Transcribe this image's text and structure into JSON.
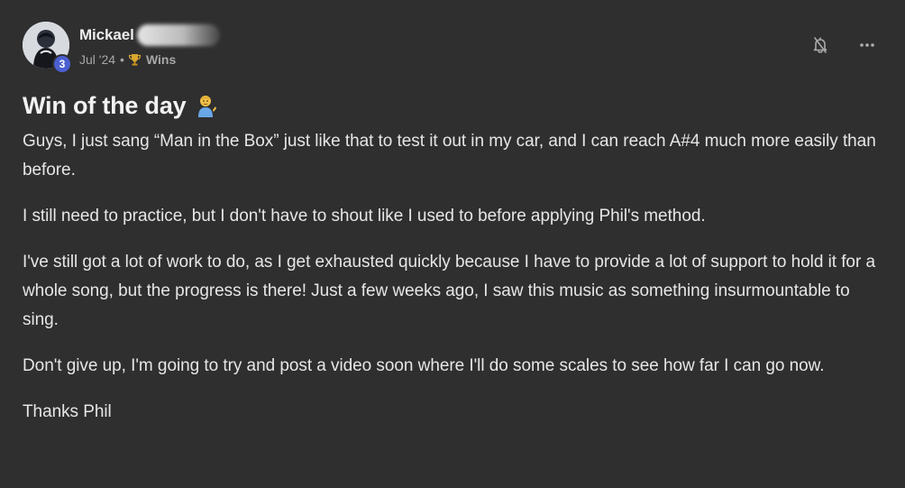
{
  "post": {
    "author": {
      "name": "Mickael",
      "level": "3"
    },
    "date": "Jul '24",
    "separator": "•",
    "category": "Wins",
    "title": "Win of the day",
    "paragraphs": [
      "Guys, I just sang “Man in the Box” just like that to test it out in my car, and I can reach A#4 much more easily than before.",
      "I still need to practice, but I don't have to shout like I used to before applying Phil's method.",
      "I've still got a lot of work to do, as I get exhausted quickly because I have to provide a lot of support to hold it for a whole song, but the progress is there! Just a few weeks ago, I saw this music as something insurmountable to sing.",
      "Don't give up, I'm going to try and post a video soon where I'll do some scales to see how far I can go now.",
      "Thanks Phil"
    ]
  },
  "icons": {
    "avatar": "avatar",
    "trophy": "trophy-icon",
    "title_emoji": "person-tipping-hand-emoji",
    "bell": "bell-slash-icon",
    "more": "more-horizontal-icon"
  },
  "colors": {
    "background": "#2f2f2f",
    "text": "#e6e6e6",
    "muted": "#a7a7a7",
    "badge": "#4b5fd1"
  }
}
